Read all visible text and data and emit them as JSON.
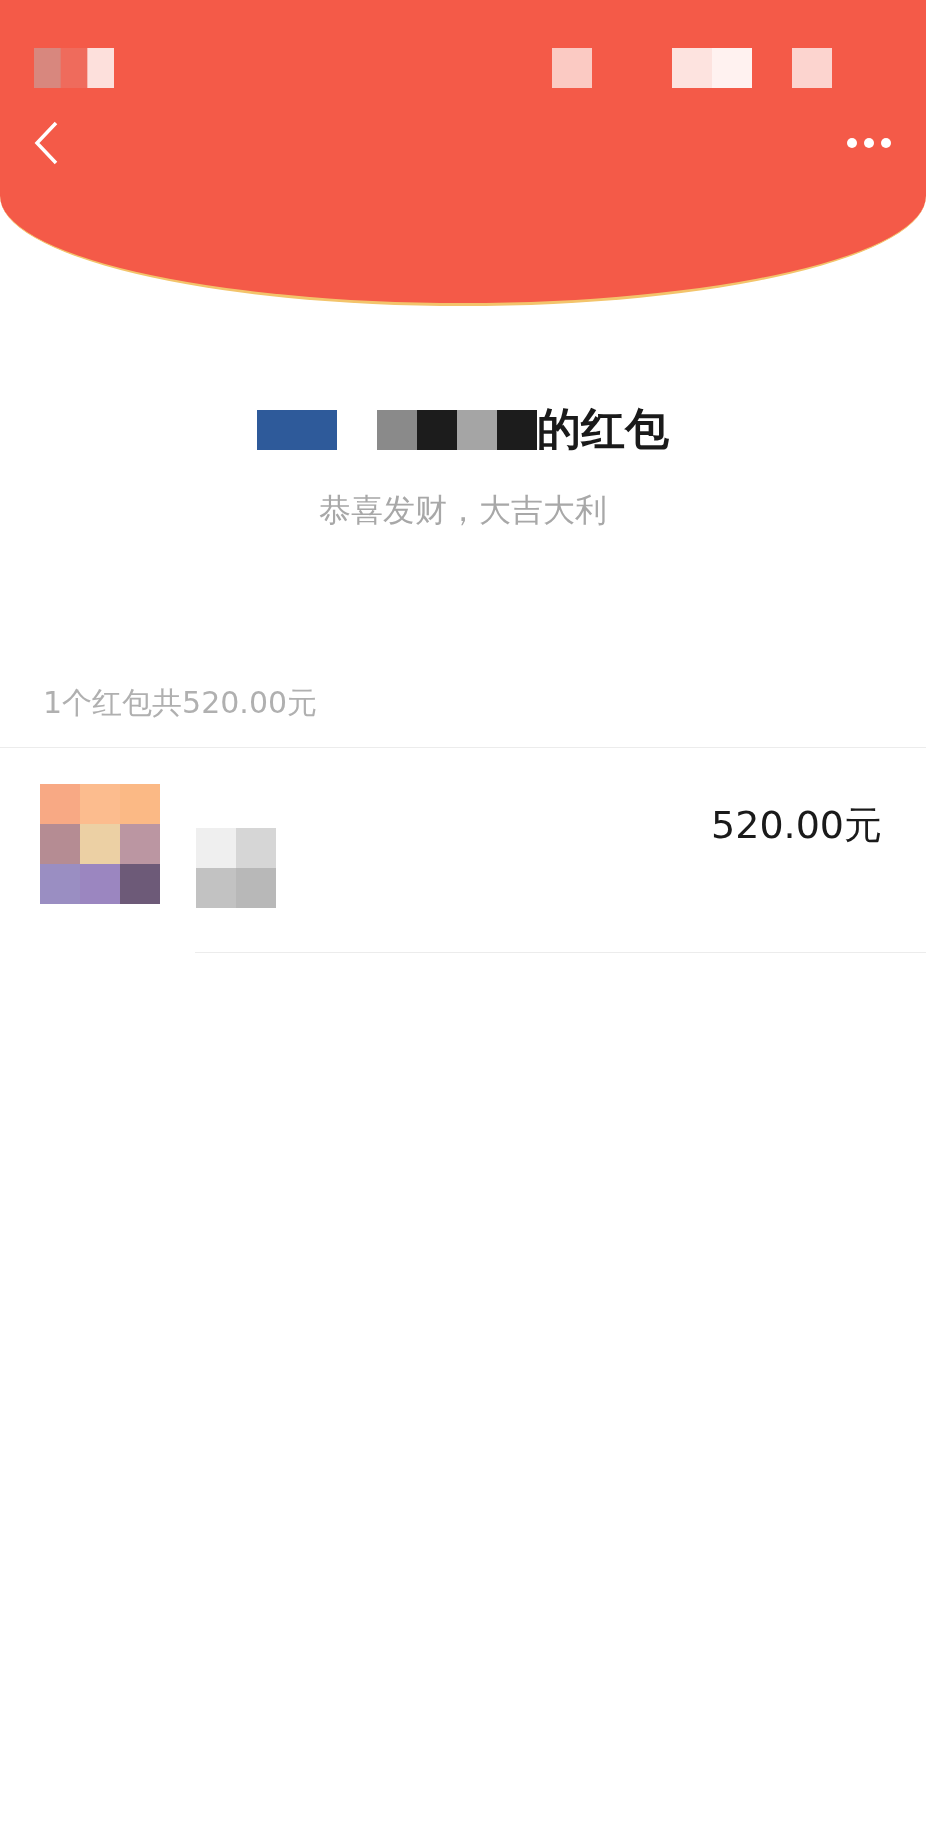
{
  "packet": {
    "title": "的红包",
    "greeting": "恭喜发财，大吉大利"
  },
  "summary": "1个红包共520.00元",
  "receivers": [
    {
      "amount": "520.00元"
    }
  ]
}
